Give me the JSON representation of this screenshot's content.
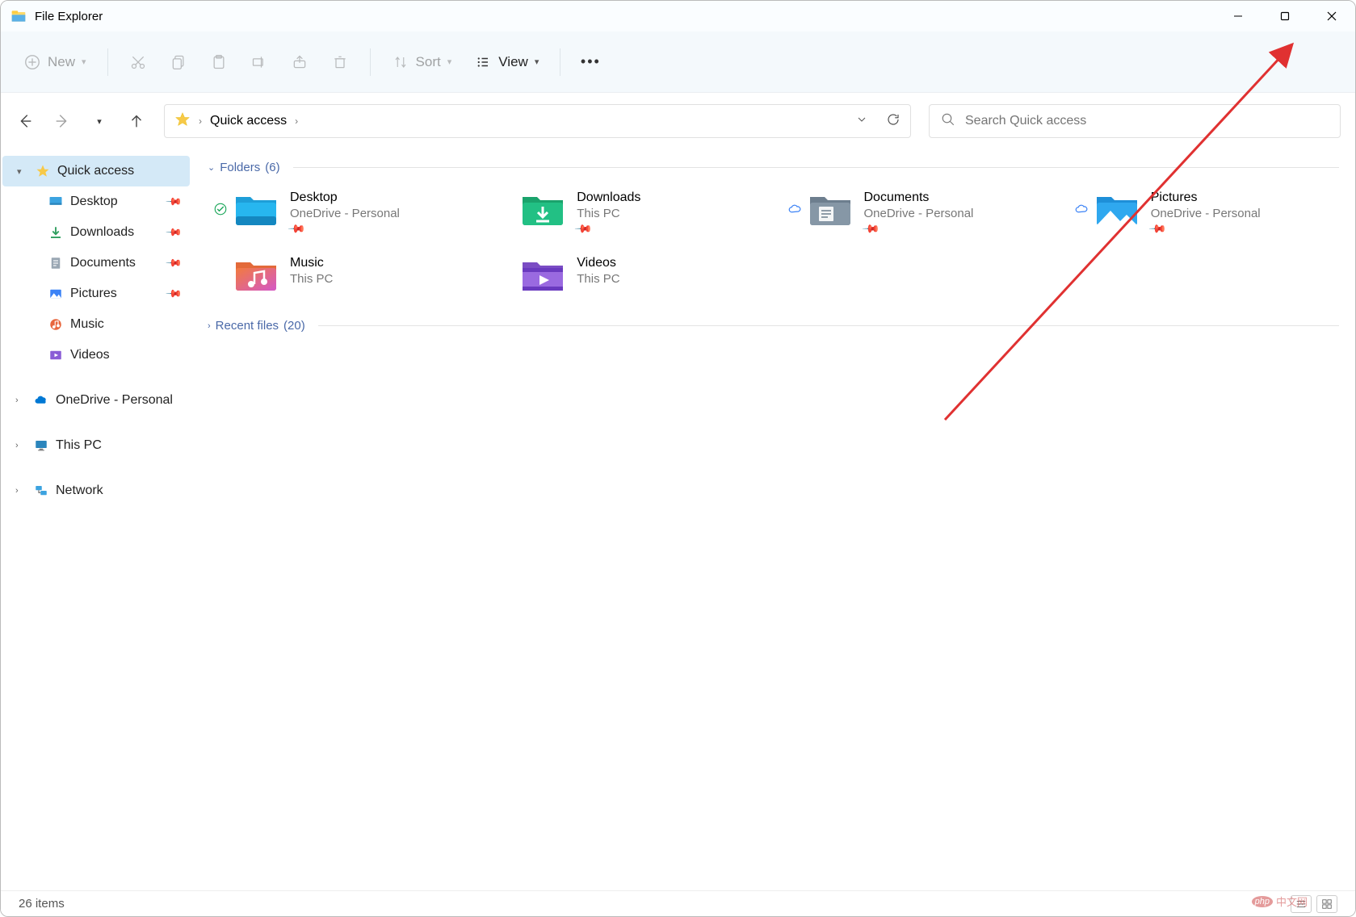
{
  "window": {
    "title": "File Explorer"
  },
  "toolbar": {
    "new": "New",
    "sort": "Sort",
    "view": "View"
  },
  "address": {
    "location": "Quick access"
  },
  "search": {
    "placeholder": "Search Quick access"
  },
  "sidebar": {
    "quick_access": "Quick access",
    "children": [
      {
        "label": "Desktop"
      },
      {
        "label": "Downloads"
      },
      {
        "label": "Documents"
      },
      {
        "label": "Pictures"
      },
      {
        "label": "Music"
      },
      {
        "label": "Videos"
      }
    ],
    "onedrive": "OneDrive - Personal",
    "this_pc": "This PC",
    "network": "Network"
  },
  "sections": {
    "folders": {
      "label": "Folders",
      "count": "(6)"
    },
    "recent": {
      "label": "Recent files",
      "count": "(20)"
    }
  },
  "folders": [
    {
      "name": "Desktop",
      "loc": "OneDrive - Personal"
    },
    {
      "name": "Downloads",
      "loc": "This PC"
    },
    {
      "name": "Documents",
      "loc": "OneDrive - Personal"
    },
    {
      "name": "Pictures",
      "loc": "OneDrive - Personal"
    },
    {
      "name": "Music",
      "loc": "This PC"
    },
    {
      "name": "Videos",
      "loc": "This PC"
    }
  ],
  "status": {
    "count": "26 items"
  },
  "watermark": {
    "brand": "php",
    "text": "中文网"
  }
}
